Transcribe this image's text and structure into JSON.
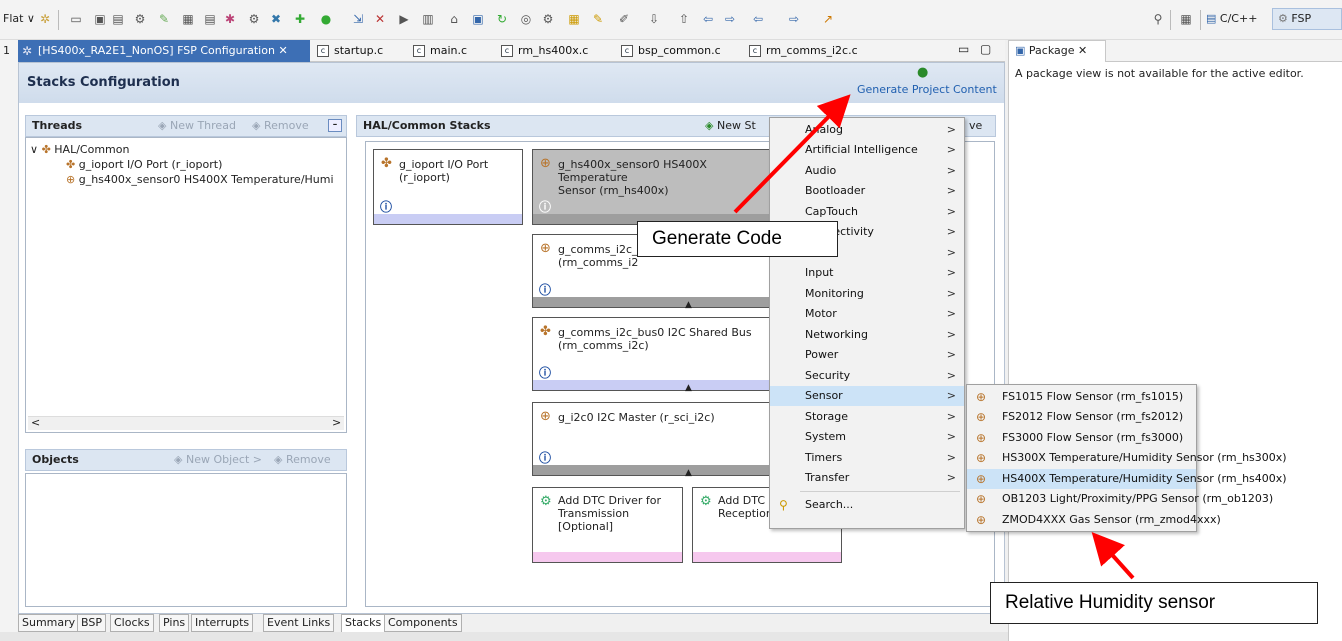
{
  "toolbar": {
    "perspective_label": "Flat",
    "cpp_label": "C/C++",
    "fsp_label": "FSP"
  },
  "editor_tabs": [
    {
      "label": "[HS400x_RA2E1_NonOS] FSP Configuration",
      "active": true
    },
    {
      "label": "startup.c"
    },
    {
      "label": "main.c"
    },
    {
      "label": "rm_hs400x.c"
    },
    {
      "label": "bsp_common.c"
    },
    {
      "label": "rm_comms_i2c.c"
    }
  ],
  "stacks": {
    "title": "Stacks Configuration",
    "generate_label": "Generate Project Content",
    "threads": {
      "title": "Threads",
      "new_thread": "New Thread",
      "remove": "Remove",
      "tree": [
        "HAL/Common",
        "g_ioport I/O Port (r_ioport)",
        "g_hs400x_sensor0 HS400X Temperature/Humi"
      ]
    },
    "objects": {
      "title": "Objects",
      "new_object": "New Object >",
      "remove": "Remove"
    },
    "hal": {
      "title": "HAL/Common Stacks",
      "new_stack": "New St",
      "remove_partial": "ve",
      "cards": [
        {
          "line1": "g_ioport I/O Port",
          "line2": "(r_ioport)"
        },
        {
          "line1": "g_hs400x_sensor0 HS400X Temperature",
          "line2": "Sensor (rm_hs400x)"
        },
        {
          "line1": "g_comms_i2c_",
          "line2": "(rm_comms_i2"
        },
        {
          "line1": "g_comms_i2c_bus0 I2C Shared Bus",
          "line2": "(rm_comms_i2c)"
        },
        {
          "line1": "g_i2c0 I2C Master (r_sci_i2c)"
        },
        {
          "line1": "Add DTC Driver for",
          "line2": "Transmission",
          "line3": "[Optional]"
        },
        {
          "line1": "Add DTC",
          "line2": "Reception"
        }
      ],
      "info_glyph": "ⓘ"
    }
  },
  "bottom_tabs": [
    "Summary",
    "BSP",
    "Clocks",
    "Pins",
    "Interrupts",
    "Event Links",
    "Stacks",
    "Components"
  ],
  "package": {
    "tab_label": "Package",
    "message": "A package view is not available for the active editor."
  },
  "category_menu": [
    "Analog",
    "Artificial Intelligence",
    "Audio",
    "Bootloader",
    "CapTouch",
    "Connectivity",
    "",
    "Input",
    "Monitoring",
    "Motor",
    "Networking",
    "Power",
    "Security",
    "Sensor",
    "Storage",
    "System",
    "Timers",
    "Transfer",
    "Search..."
  ],
  "sensor_menu": [
    "FS1015 Flow Sensor (rm_fs1015)",
    "FS2012 Flow Sensor (rm_fs2012)",
    "FS3000 Flow Sensor (rm_fs3000)",
    "HS300X Temperature/Humidity Sensor (rm_hs300x)",
    "HS400X Temperature/Humidity Sensor (rm_hs400x)",
    "OB1203 Light/Proximity/PPG Sensor (rm_ob1203)",
    "ZMOD4XXX Gas Sensor (rm_zmod4xxx)"
  ],
  "annotations": {
    "generate_code": "Generate Code",
    "humidity_sensor": "Relative Humidity sensor"
  },
  "colors": {
    "arrow": "#ff0000",
    "active_tab": "#3d6fb5",
    "selected_menu": "#cce3f7"
  }
}
